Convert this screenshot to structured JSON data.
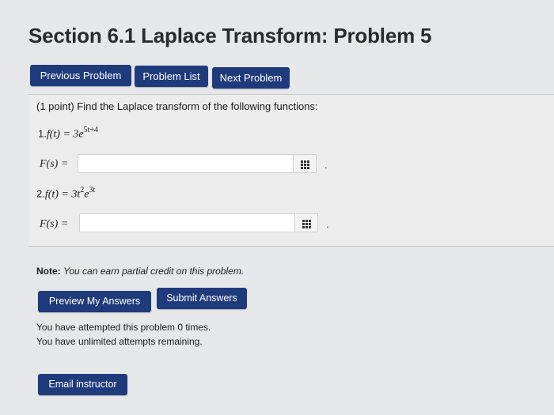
{
  "page": {
    "title": "Section 6.1 Laplace Transform: Problem 5"
  },
  "nav": {
    "previous_label": "Previous Problem",
    "list_label": "Problem List",
    "next_label": "Next Problem"
  },
  "problem": {
    "intro": "(1 point) Find the Laplace transform of the following functions:",
    "parts": [
      {
        "number": "1.",
        "lhs": "f(t) = 3e",
        "exponent": "5t+4",
        "answer_label": "F(s) =",
        "answer_value": ""
      },
      {
        "number": "2.",
        "lhs": "f(t) = 3t",
        "exponent1": "2",
        "mid": "e",
        "exponent2": "3t",
        "answer_label": "F(s) =",
        "answer_value": ""
      }
    ],
    "trailing_dot": "."
  },
  "note": {
    "prefix": "Note:",
    "text": "You can earn partial credit on this problem."
  },
  "actions": {
    "preview_label": "Preview My Answers",
    "submit_label": "Submit Answers"
  },
  "attempts": {
    "line1": "You have attempted this problem 0 times.",
    "line2": "You have unlimited attempts remaining."
  },
  "email": {
    "label": "Email instructor"
  },
  "colors": {
    "button_bg": "#1f3b7c",
    "page_bg": "#e6e7e9"
  },
  "icons": {
    "palette": "equation-palette-icon"
  }
}
